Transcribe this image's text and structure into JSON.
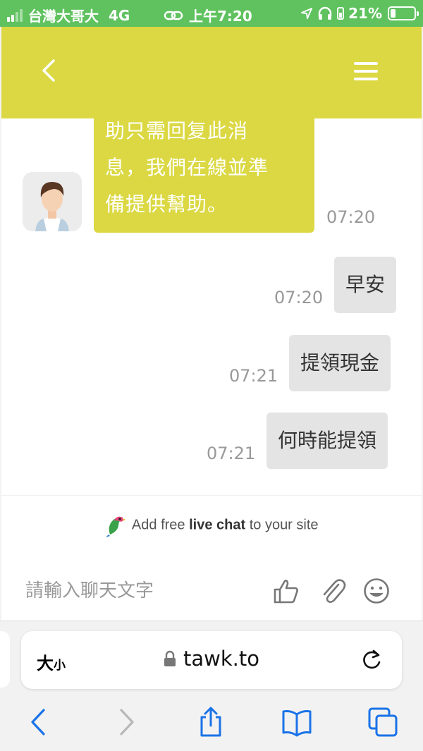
{
  "status_bar": {
    "carrier": "台灣大哥大",
    "network": "4G",
    "time": "上午7:20",
    "battery": "21%",
    "battery_level": 0.21
  },
  "chat": {
    "agent_message_lines": [
      "助只需回复此消",
      "息，我們在線並準",
      "備提供幫助。"
    ],
    "agent_time": "07:20",
    "user_messages": [
      {
        "text": "早安",
        "time": "07:20"
      },
      {
        "text": "提領現金",
        "time": "07:21"
      },
      {
        "text": "何時能提領",
        "time": "07:21"
      }
    ]
  },
  "promo": {
    "prefix": "Add free",
    "bold": "live chat",
    "suffix": "to your site"
  },
  "composer": {
    "placeholder": "請輸入聊天文字"
  },
  "browser": {
    "text_size_label_big": "大",
    "text_size_label_small": "小",
    "url": "tawk.to"
  },
  "icons": {
    "header": [
      "back-chevron-icon",
      "hamburger-menu-icon"
    ],
    "composer": [
      "thumbs-up-icon",
      "paperclip-icon",
      "emoji-icon"
    ],
    "browser_nav": [
      "back-icon",
      "forward-icon",
      "share-icon",
      "bookmarks-icon",
      "tabs-icon"
    ]
  },
  "colors": {
    "accent": "#dbd843",
    "status_bar": "#5fc25f",
    "ios_blue": "#1a73e8",
    "user_bubble": "#e4e4e4"
  }
}
